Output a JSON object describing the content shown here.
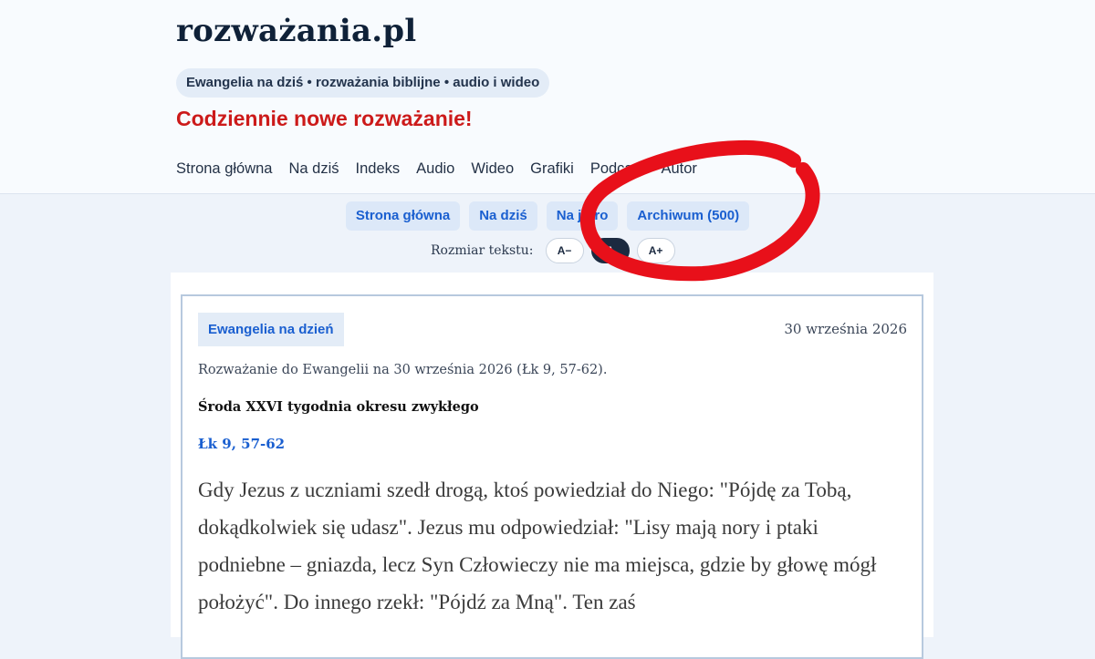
{
  "site": {
    "logo": "rozważania.pl",
    "tagline": "Ewangelia na dziś • rozważania biblijne • audio i wideo",
    "promo": "Codziennie nowe rozważanie!"
  },
  "topnav": [
    "Strona główna",
    "Na dziś",
    "Indeks",
    "Audio",
    "Wideo",
    "Grafiki",
    "Podcast",
    "Autor"
  ],
  "subnav": [
    "Strona główna",
    "Na dziś",
    "Na jutro",
    "Archiwum (500)"
  ],
  "text_size": {
    "label": "Rozmiar tekstu:",
    "decrease": "A−",
    "default": "A",
    "increase": "A+",
    "selected": "default"
  },
  "article": {
    "tag": "Ewangelia na dzień",
    "date": "30 września 2026",
    "intro": "Rozważanie do Ewangelii na 30 września 2026 (Łk 9, 57-62).",
    "day": "Środa XXVI tygodnia okresu zwykłego",
    "reference": "Łk 9, 57-62",
    "text": "Gdy Jezus z uczniami szedł drogą, ktoś powiedział do Niego: \"Pójdę za Tobą, dokądkolwiek się udasz\". Jezus mu odpowiedział: \"Lisy mają nory i ptaki podniebne – gniazda, lecz Syn Człowieczy nie ma miejsca, gdzie by głowę mógł położyć\". Do innego rzekł: \"Pójdź za Mną\". Ten zaś"
  },
  "colors": {
    "promo": "#cc1a1a",
    "link": "#1a5fd0",
    "annotation": "#e8101a"
  }
}
